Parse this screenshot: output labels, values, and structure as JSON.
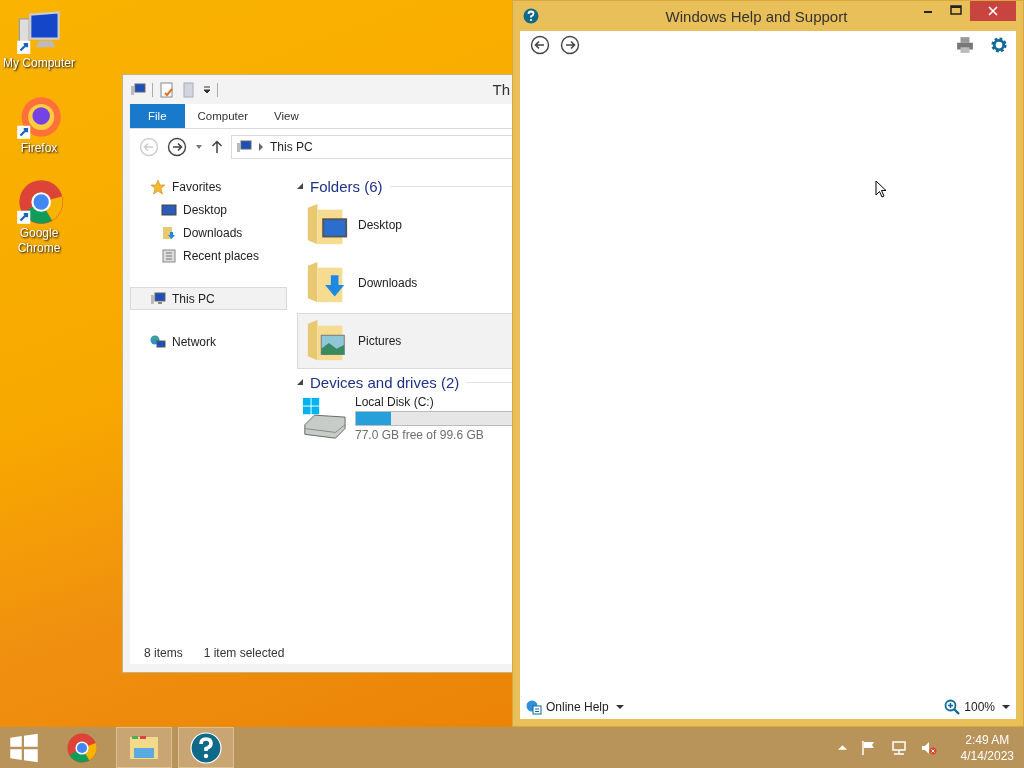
{
  "desktop_icons": [
    {
      "label": "My Computer",
      "kind": "computer"
    },
    {
      "label": "Firefox",
      "kind": "firefox"
    },
    {
      "label": "Google Chrome",
      "kind": "chrome"
    }
  ],
  "explorer": {
    "title": "Th",
    "tabs": [
      {
        "label": "File",
        "kind": "file",
        "selected": false
      },
      {
        "label": "Computer",
        "kind": "tab",
        "selected": false
      },
      {
        "label": "View",
        "kind": "tab",
        "selected": false
      }
    ],
    "back_disabled": true,
    "address": "This PC",
    "navigation": [
      {
        "label": "Favorites",
        "kind": "star",
        "selected": false,
        "children": [
          {
            "label": "Desktop",
            "kind": "desktop",
            "selected": false
          },
          {
            "label": "Downloads",
            "kind": "downloads",
            "selected": false
          },
          {
            "label": "Recent places",
            "kind": "recent",
            "selected": false
          }
        ]
      },
      {
        "label": "This PC",
        "kind": "pc",
        "selected": true
      },
      {
        "label": "Network",
        "kind": "network",
        "selected": false
      }
    ],
    "sections": [
      {
        "title": "Folders (6)",
        "kind": "folders",
        "items": [
          {
            "label": "Desktop",
            "kind": "desktop",
            "selected": false
          },
          {
            "label": "Downloads",
            "kind": "downloads",
            "selected": false
          },
          {
            "label": "Pictures",
            "kind": "pictures",
            "selected": true
          }
        ]
      },
      {
        "title": "Devices and drives (2)",
        "kind": "drives",
        "items": [
          {
            "label": "Local Disk (C:)",
            "level": 0.227,
            "reading": "77.0 GB free of 99.6 GB"
          }
        ]
      }
    ],
    "status_bar": [
      "8 items",
      "1 item selected"
    ]
  },
  "help": {
    "title": "Windows Help and Support",
    "online_help": "Online Help",
    "zoom": "100%"
  },
  "taskbar": {
    "apps": [
      {
        "kind": "chrome",
        "running": false
      },
      {
        "kind": "explorer",
        "running": true
      },
      {
        "kind": "help",
        "running": true
      }
    ],
    "time": "2:49 AM",
    "date": "4/14/2023"
  }
}
